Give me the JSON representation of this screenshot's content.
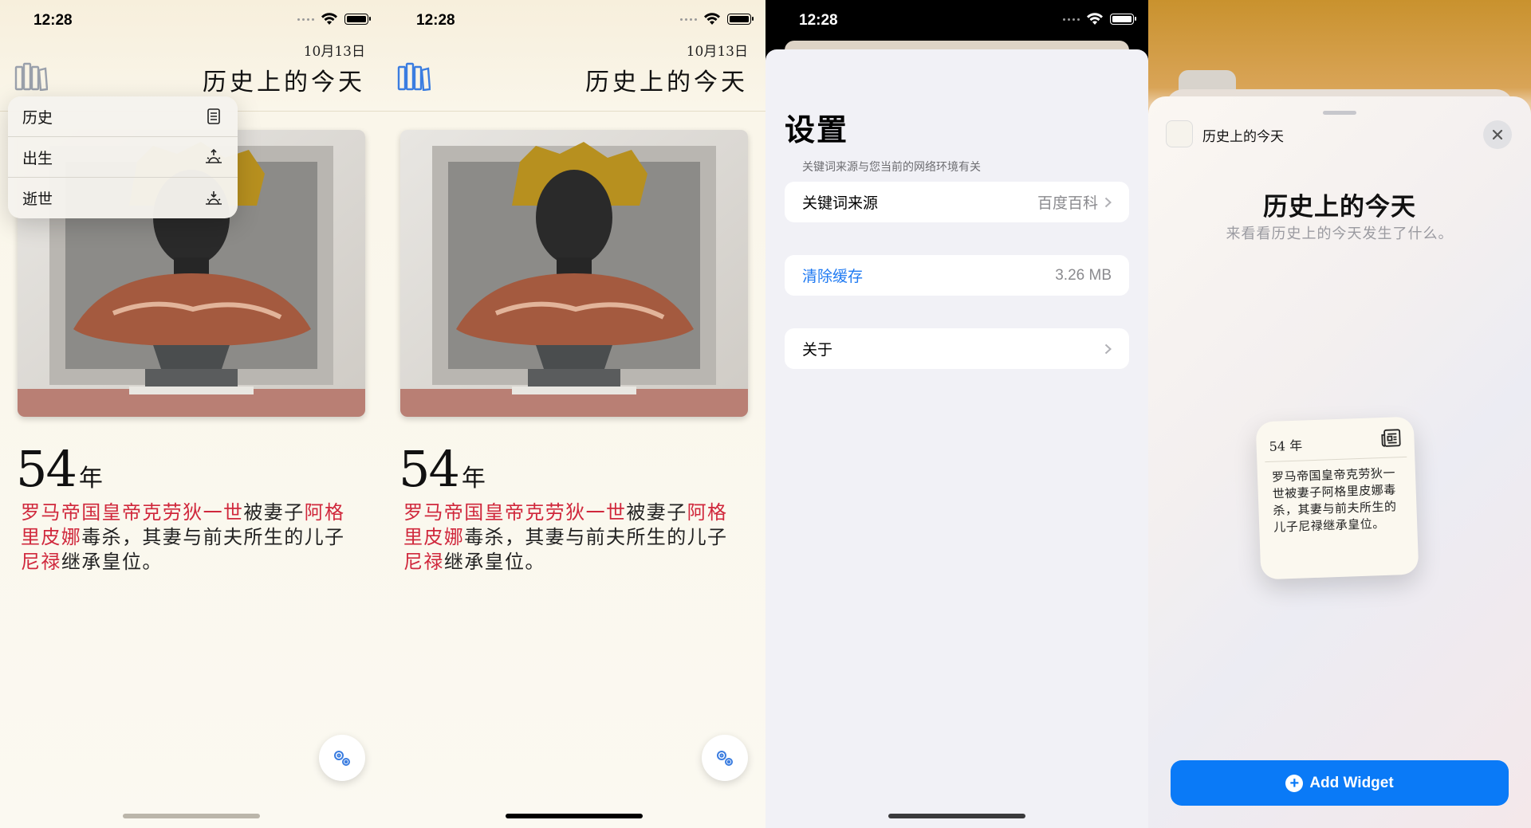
{
  "status": {
    "time": "12:28"
  },
  "header": {
    "date": "10月13日",
    "title": "历史上的今天"
  },
  "menu": {
    "items": [
      {
        "label": "历史",
        "icon": "newspaper-icon"
      },
      {
        "label": "出生",
        "icon": "sunrise-icon"
      },
      {
        "label": "逝世",
        "icon": "sunset-icon"
      }
    ]
  },
  "event": {
    "year": "54",
    "year_unit": "年",
    "segments": [
      {
        "text": "罗马帝国皇帝克劳狄一世",
        "highlight": true
      },
      {
        "text": "被妻子",
        "highlight": false
      },
      {
        "text": "阿格里皮娜",
        "highlight": true
      },
      {
        "text": "毒杀，其妻与前夫所生的儿子",
        "highlight": false
      },
      {
        "text": "尼禄",
        "highlight": true
      },
      {
        "text": "继承皇位。",
        "highlight": false
      }
    ]
  },
  "settings": {
    "title": "设置",
    "hint": "关键词来源与您当前的网络环境有关",
    "keyword_source_label": "关键词来源",
    "keyword_source_value": "百度百科",
    "clear_cache_label": "清除缓存",
    "cache_size": "3.26 MB",
    "about_label": "关于"
  },
  "widget_sheet": {
    "app_name": "历史上的今天",
    "title": "历史上的今天",
    "subtitle": "来看看历史上的今天发生了什么。",
    "widget_year": "54 年",
    "widget_text": "罗马帝国皇帝克劳狄一世被妻子阿格里皮娜毒杀，其妻与前夫所生的儿子尼禄继承皇位。",
    "add_button": "Add Widget"
  },
  "colors": {
    "accent_red": "#d0283c",
    "link_blue": "#1f7af2",
    "button_blue": "#0a7af7",
    "books_icon_gray": "#9aa0ab",
    "books_icon_blue": "#3b7de0"
  }
}
